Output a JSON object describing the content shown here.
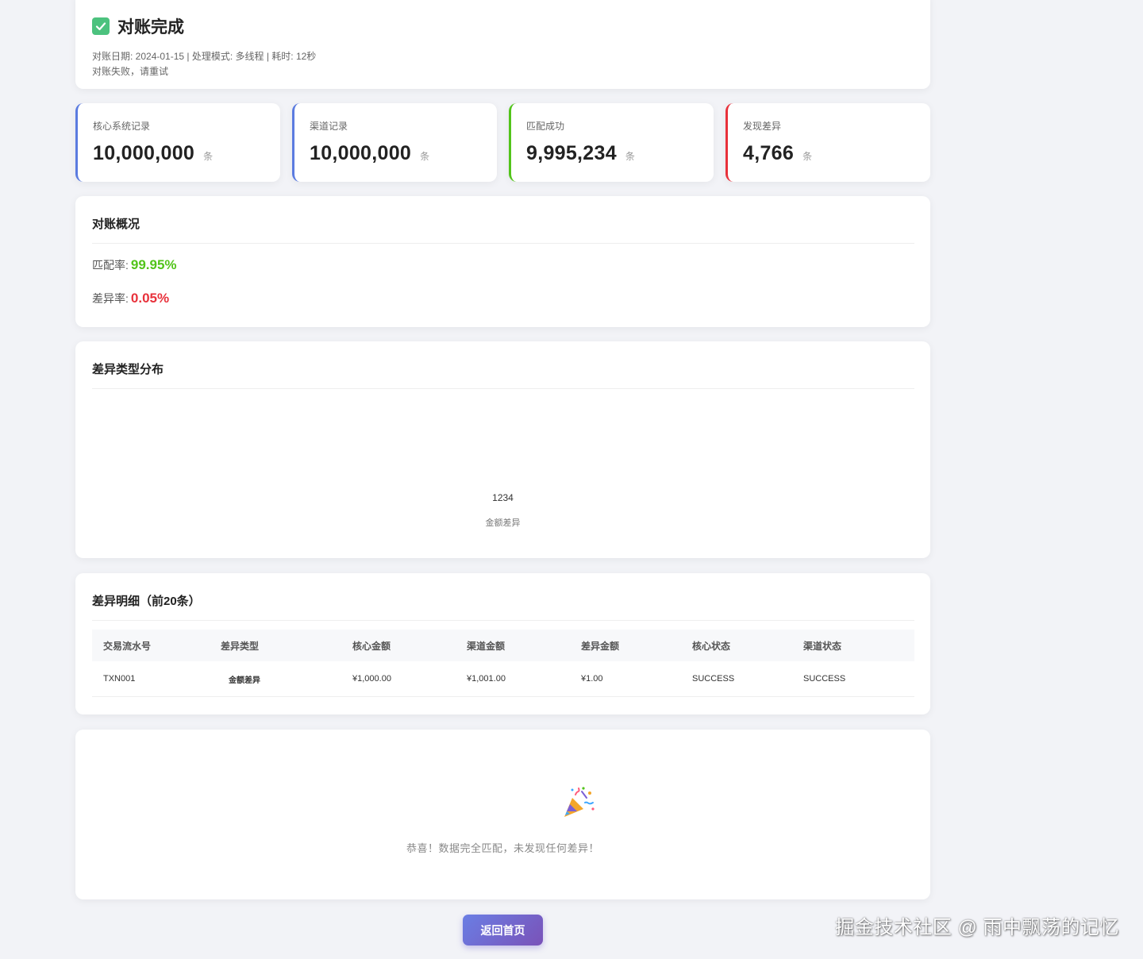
{
  "header": {
    "title": "对账完成",
    "meta": "对账日期: 2024-01-15 | 处理模式: 多线程 | 耗时: 12秒",
    "error": "对账失败，请重试"
  },
  "stats": [
    {
      "label": "核心系统记录",
      "value": "10,000,000",
      "unit": "条",
      "accent": "#5b7be0"
    },
    {
      "label": "渠道记录",
      "value": "10,000,000",
      "unit": "条",
      "accent": "#5b7be0"
    },
    {
      "label": "匹配成功",
      "value": "9,995,234",
      "unit": "条",
      "accent": "#52c41a"
    },
    {
      "label": "发现差异",
      "value": "4,766",
      "unit": "条",
      "accent": "#e8313b"
    }
  ],
  "overview": {
    "title": "对账概况",
    "match_label": "匹配率:",
    "match_value": "99.95%",
    "diff_label": "差异率:",
    "diff_value": "0.05%"
  },
  "distribution": {
    "title": "差异类型分布",
    "count": "1234",
    "label": "金额差异"
  },
  "details": {
    "title": "差异明细（前20条）",
    "columns": [
      "交易流水号",
      "差异类型",
      "核心金额",
      "渠道金额",
      "差异金额",
      "核心状态",
      "渠道状态"
    ],
    "rows": [
      [
        "TXN001",
        "金额差异",
        "¥1,000.00",
        "¥1,001.00",
        "¥1.00",
        "SUCCESS",
        "SUCCESS"
      ]
    ]
  },
  "empty": {
    "icon": "party-popper-icon",
    "text": "恭喜！数据完全匹配，未发现任何差异！"
  },
  "back_button": "返回首页",
  "watermark": "掘金技术社区 @ 雨中飘荡的记忆",
  "colors": {
    "success": "#52c41a",
    "danger": "#e8313b",
    "primary": "#5b7be0",
    "button_gradient_start": "#6a7ee4",
    "button_gradient_end": "#7a52b8"
  }
}
